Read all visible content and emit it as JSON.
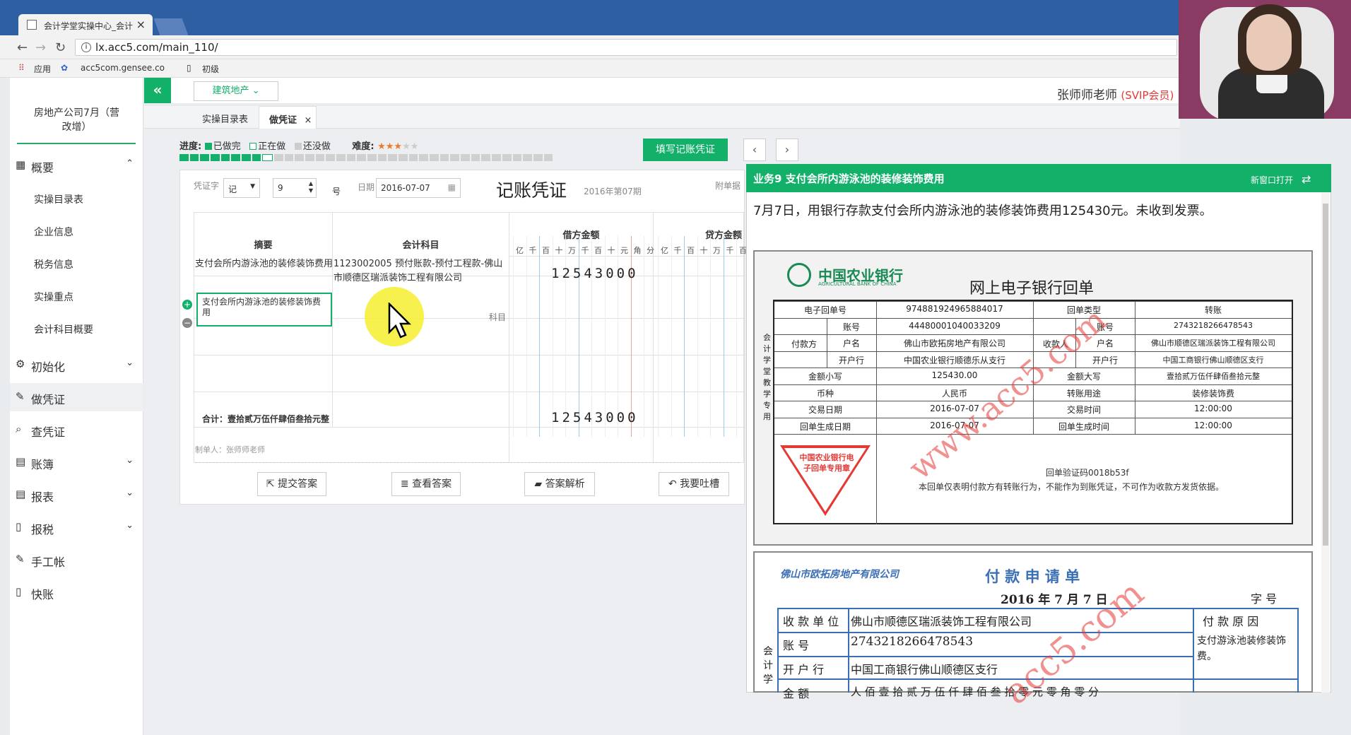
{
  "browser": {
    "tab_title": "会计学堂实操中心_会计",
    "tab_close": "×",
    "url": "lx.acc5.com/main_110/",
    "bookmarks": [
      "应用",
      "acc5com.gensee.co",
      "初级"
    ]
  },
  "app": {
    "company": "房地产公司7月（营改增）",
    "collapse": "«",
    "category": "建筑地产 ⌄",
    "user_name": "张师师老师",
    "user_level": "(SVIP会员)",
    "page_tabs": [
      "实操目录表",
      "做凭证"
    ],
    "tab_close": "×"
  },
  "sidebar": {
    "items": [
      {
        "label": "概要",
        "icon": "grid-icon",
        "chev": "⌃"
      },
      {
        "label": "初始化",
        "icon": "gear-icon",
        "chev": "⌄"
      },
      {
        "label": "做凭证",
        "icon": "pen-icon",
        "chev": ""
      },
      {
        "label": "查凭证",
        "icon": "search-icon",
        "chev": ""
      },
      {
        "label": "账簿",
        "icon": "book-icon",
        "chev": "⌄"
      },
      {
        "label": "报表",
        "icon": "report-icon",
        "chev": "⌄"
      },
      {
        "label": "报税",
        "icon": "file-icon",
        "chev": "⌄"
      },
      {
        "label": "手工帐",
        "icon": "pen-icon",
        "chev": ""
      },
      {
        "label": "快账",
        "icon": "file-icon",
        "chev": ""
      }
    ],
    "sub_items": [
      "实操目录表",
      "企业信息",
      "税务信息",
      "实操重点",
      "会计科目概要"
    ]
  },
  "progress": {
    "label": "进度:",
    "done": "已做完",
    "doing": "正在做",
    "todo": "还没做",
    "difficulty": "难度:",
    "stars": "★★★",
    "stars_dim": "★★",
    "done_count": 8,
    "total": 36,
    "colors": {
      "done": "#13b06a",
      "doing": "#ffffff",
      "todo": "#d0d0d0"
    }
  },
  "toolbar": {
    "fill_button": "填写记账凭证",
    "prev": "‹",
    "next": "›"
  },
  "voucher": {
    "word_label": "凭证字",
    "word_value": "记",
    "number_value": "9",
    "number_suffix": "号",
    "date_label": "日期",
    "date_value": "2016-07-07",
    "title": "记账凭证",
    "period": "2016年第07期",
    "attach_label": "附单据",
    "headers": {
      "summary": "摘要",
      "account": "会计科目",
      "debit": "借方金额",
      "credit": "贷方金额"
    },
    "digit_units": [
      "亿",
      "千",
      "百",
      "十",
      "万",
      "千",
      "百",
      "十",
      "元",
      "角",
      "分"
    ],
    "credit_units": [
      "亿",
      "千",
      "百",
      "十",
      "万",
      "千",
      "百"
    ],
    "row1_summary": "支付会所内游泳池的装修装饰费用",
    "row1_account": "1123002005 预付账款-预付工程款-佛山市顺德区瑞派装饰工程有限公司",
    "row1_debit": "12543000",
    "row2_summary_edit": "支付会所内游泳池的装修装饰费用",
    "row2_account_placeholder": "科目",
    "total_label": "合计：壹拾贰万伍仟肆佰叁拾元整",
    "total_debit": "12543000",
    "maker": "制单人：张师师老师"
  },
  "actions": {
    "submit": "提交答案",
    "view": "查看答案",
    "analysis": "答案解析",
    "feedback": "我要吐槽"
  },
  "task": {
    "title": "业务9 支付会所内游泳池的装修装饰费用",
    "new_window": "新窗口打开",
    "description": "7月7日，用银行存款支付会所内游泳池的装修装饰费用125430元。未收到发票。"
  },
  "receipt": {
    "bank_name": "中国农业银行",
    "bank_name_en": "AGRICULTURAL BANK OF CHINA",
    "title": "网上电子银行回单",
    "side_label": "会计学堂教学专用",
    "rows": [
      [
        "电子回单号",
        "974881924965884017",
        "回单类型",
        "转账"
      ],
      [
        "账号",
        "44480001040033209",
        "账号",
        "274321826647854​3"
      ],
      [
        "户名",
        "佛山市欧拓房地产有限公司",
        "户名",
        "佛山市顺德区瑞派装饰工程有限公司"
      ],
      [
        "开户行",
        "中国农业银行顺德乐从支行",
        "开户行",
        "中国工商银行佛山顺德区支行"
      ],
      [
        "金额小写",
        "125430.00",
        "金额大写",
        "壹拾贰万伍仟肆佰叁拾元整"
      ],
      [
        "币种",
        "人民币",
        "转账用途",
        "装修装饰费"
      ],
      [
        "交易日期",
        "2016-07-07",
        "交易时间",
        "12:00:00"
      ],
      [
        "回单生成日期",
        "2016-07-07",
        "回单生成时间",
        "12:00:00"
      ]
    ],
    "payer_label": "付款方",
    "payee_label": "收款人",
    "stamp": "中国农业银行电子回单专用章",
    "verify": "回单验证码0018b53f",
    "note": "本回单仅表明付款方有转账行为，不能作为到账凭证，不可作为收款方发货依据。",
    "watermark1": "www.acc5.com",
    "watermark2": "acc5.com"
  },
  "payform": {
    "company": "佛山市欧拓房地产有限公司",
    "title": "付 款 申 请 单",
    "date": "2016 年 7 月 7 日",
    "number_label": "字  号",
    "payee_label": "收 款 单 位",
    "payee": "佛山市顺德区瑞派装饰工程有限公司",
    "reason_label": "付 款 原 因",
    "account_label": "账    号",
    "account": "27432182664785​43",
    "reason": "支付游泳池装修装饰费。",
    "bank_label": "开 户 行",
    "bank": "中国工商银行佛山顺德区支行",
    "amount_label": "金    额",
    "amount_partial": "人 佰 壹 拾 贰 万 伍 仟 肆 佰 叁 拾 零 元 零 角 零 分",
    "side": "会计学",
    "watermark": "acc5.com"
  }
}
